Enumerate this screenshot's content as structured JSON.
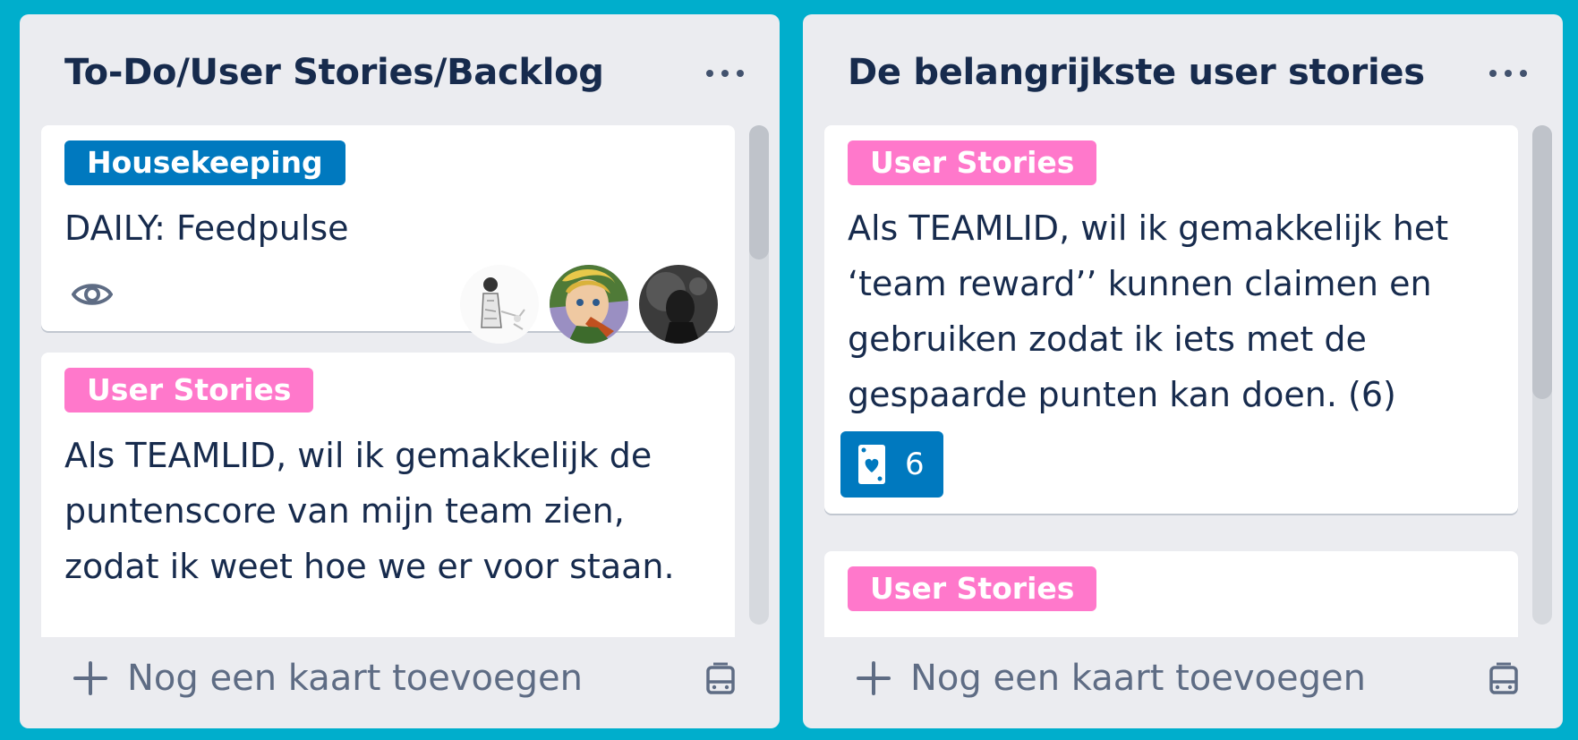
{
  "lists": [
    {
      "title": "To-Do/User Stories/Backlog",
      "add_card_label": "Nog een kaart toevoegen",
      "cards": [
        {
          "label": "Housekeeping",
          "label_color": "#0079bf",
          "title": "DAILY: Feedpulse",
          "icons": [
            "eye-icon"
          ],
          "members": [
            "avatar-sketch",
            "avatar-cartoon",
            "avatar-dark"
          ]
        },
        {
          "label": "User Stories",
          "label_color": "#ff78cb",
          "title_lines": [
            "Als TEAMLID, wil ik gemakkelijk de",
            "puntenscore van mijn team zien,",
            "zodat ik weet hoe we er voor staan."
          ]
        }
      ]
    },
    {
      "title": "De belangrijkste user stories",
      "add_card_label": "Nog een kaart toevoegen",
      "cards": [
        {
          "label": "User Stories",
          "label_color": "#ff78cb",
          "title_lines": [
            "Als TEAMLID, wil ik gemakkelijk het",
            "‘team reward’’ kunnen claimen en",
            "gebruiken zodat ik iets met de",
            "gespaarde punten kan doen. (6)"
          ],
          "badge": {
            "icon": "planning-poker-card-icon",
            "value": "6",
            "color": "#0079bf"
          }
        },
        {
          "label": "User Stories",
          "label_color": "#ff78cb"
        }
      ]
    }
  ],
  "colors": {
    "board_background": "#00aecc",
    "list_background": "#ebecf0",
    "text": "#172b4d"
  }
}
